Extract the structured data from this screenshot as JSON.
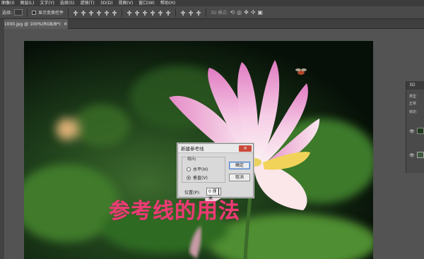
{
  "menubar": {
    "items": [
      "图像(I)",
      "图层(L)",
      "文字(Y)",
      "选择(S)",
      "滤镜(T)",
      "3D(D)",
      "视图(V)",
      "窗口(W)",
      "帮助(H)"
    ]
  },
  "options": {
    "select_label": "选择:",
    "show_transform": "显示变换控件",
    "mode_label": "3D 模式:"
  },
  "document": {
    "tab_title": "01000.jpg @ 100%(RGB/8*)",
    "close_glyph": "×"
  },
  "right_panel": {
    "tab": "3D",
    "line1": "类型",
    "line2": "正常",
    "line3": "锁定:"
  },
  "dialog": {
    "title": "新建参考线",
    "close_glyph": "×",
    "group_label": "取向",
    "horizontal_label": "水平(H)",
    "vertical_label": "垂直(V)",
    "selected": "vertical",
    "ok_label": "确定",
    "cancel_label": "取消",
    "position_label": "位置(P):",
    "position_value": "0 厘米"
  },
  "caption": {
    "text": "参考线的用法",
    "color": "#ea3c74"
  },
  "colors": {
    "app_bg": "#535353",
    "menubar_bg": "#3c3c3c",
    "dialog_close": "#c94a3a"
  }
}
